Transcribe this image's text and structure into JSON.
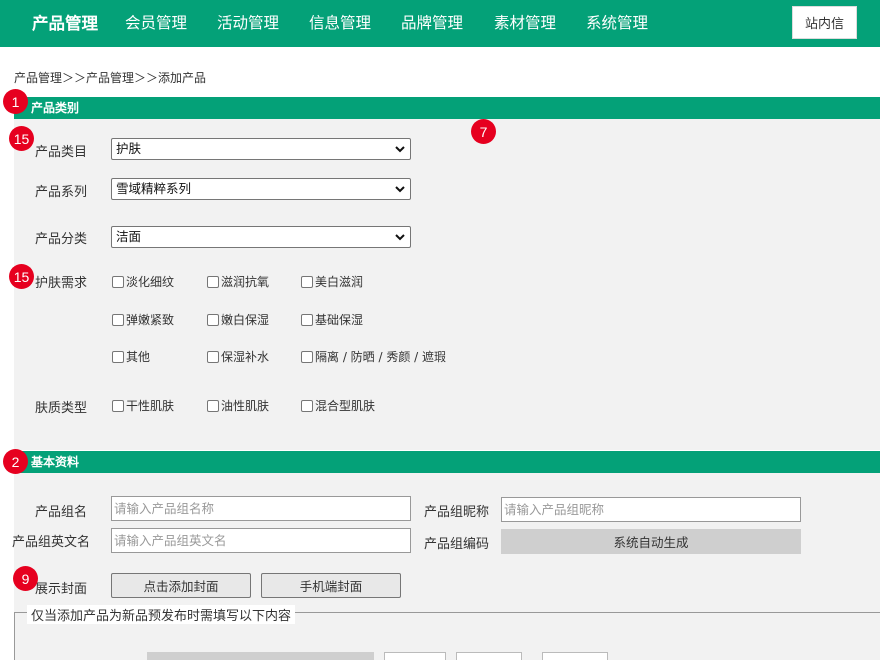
{
  "nav": {
    "items": [
      "产品管理",
      "会员管理",
      "活动管理",
      "信息管理",
      "品牌管理",
      "素材管理",
      "系统管理"
    ],
    "message_button": "站内信"
  },
  "breadcrumb": "产品管理＞＞产品管理＞＞添加产品",
  "badges": [
    "1",
    "15",
    "7",
    "15",
    "2",
    "9"
  ],
  "category_section": {
    "title": "产品类别",
    "category_label": "产品类目",
    "category_value": "护肤",
    "series_label": "产品系列",
    "series_value": "雪域精粹系列",
    "class_label": "产品分类",
    "class_value": "洁面",
    "needs_label": "护肤需求",
    "needs_options": [
      "淡化细纹",
      "滋润抗氧",
      "美白滋润",
      "弹嫩紧致",
      "嫩白保湿",
      "基础保湿",
      "其他",
      "保湿补水",
      "隔离 / 防晒 / 秀颜 / 遮瑕"
    ],
    "skin_label": "肤质类型",
    "skin_options": [
      "干性肌肤",
      "油性肌肤",
      "混合型肌肤"
    ]
  },
  "basic_section": {
    "title": "基本资料",
    "group_name_label": "产品组名",
    "group_name_placeholder": "请输入产品组名称",
    "nickname_label": "产品组昵称",
    "nickname_placeholder": "请输入产品组昵称",
    "english_label": "产品组英文名",
    "english_placeholder": "请输入产品组英文名",
    "code_label": "产品组编码",
    "code_value": "系统自动生成",
    "cover_label": "展示封面",
    "add_cover_button": "点击添加封面",
    "mobile_cover_button": "手机端封面"
  },
  "presale_legend": "仅当添加产品为新品预发布时需填写以下内容",
  "colors": {
    "brand": "#04a178",
    "badge": "#e6001f",
    "panel": "#f2f2f2"
  }
}
